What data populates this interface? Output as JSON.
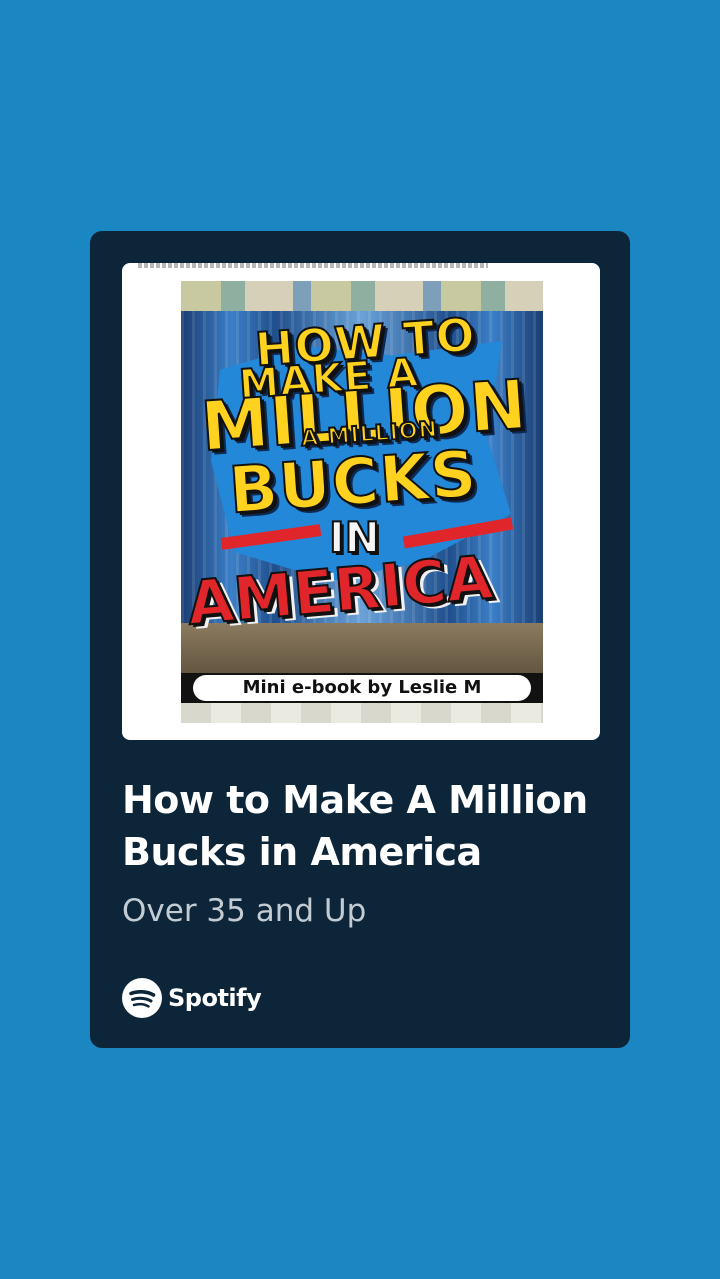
{
  "background_color": "#1a86c2",
  "card": {
    "background_color": "#0c2538",
    "title": "How to Make A Million Bucks in America",
    "subtitle": "Over 35 and Up",
    "brand": {
      "name": "Spotify",
      "icon": "spotify-icon"
    }
  },
  "cover": {
    "line1": "HOW TO",
    "line2": "MAKE A",
    "line3": "MILLION",
    "line4": "A MILLION",
    "line5": "BUCKS",
    "line6": "IN",
    "line7": "AMERICA",
    "byline": "Mini e-book by Leslie M"
  }
}
